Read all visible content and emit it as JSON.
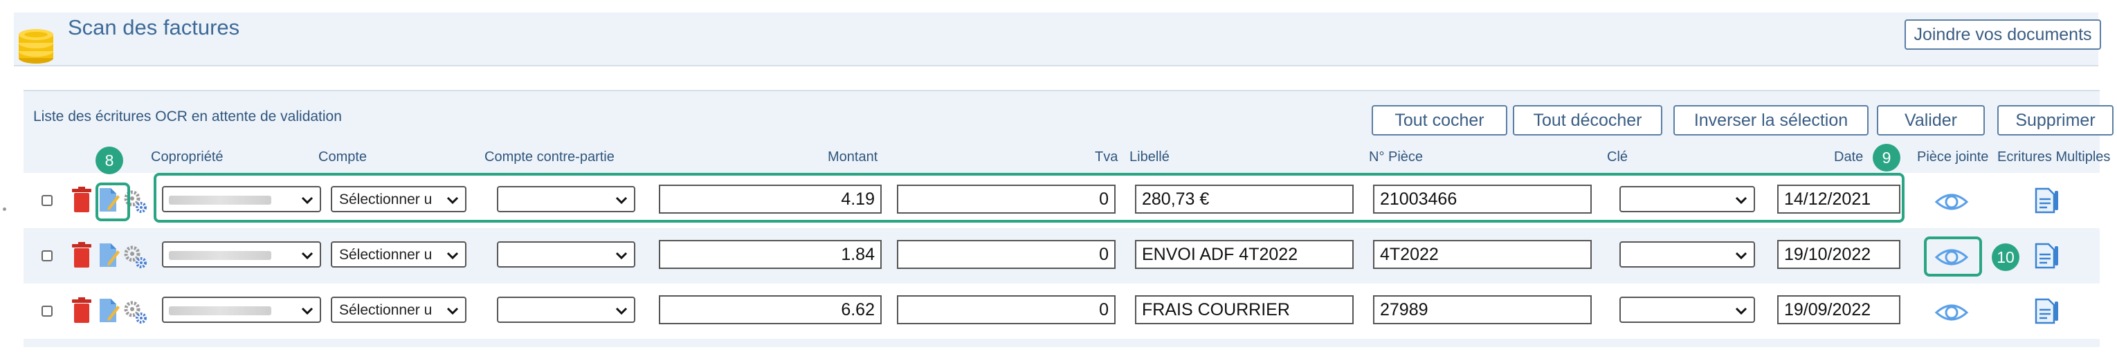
{
  "header": {
    "title": "Scan des factures",
    "join_button": "Joindre vos documents"
  },
  "list": {
    "title": "Liste des écritures OCR en attente de validation",
    "buttons": {
      "check_all": "Tout cocher",
      "uncheck_all": "Tout décocher",
      "invert": "Inverser la sélection",
      "validate": "Valider",
      "delete": "Supprimer"
    },
    "columns": {
      "copropriete": "Copropriété",
      "compte": "Compte",
      "contre_partie": "Compte contre-partie",
      "montant": "Montant",
      "tva": "Tva",
      "libelle": "Libellé",
      "piece": "N° Pièce",
      "cle": "Clé",
      "date": "Date",
      "piece_jointe": "Pièce jointe",
      "ecritures_multiples": "Ecritures Multiples"
    },
    "rows": [
      {
        "compte": "Sélectionner u",
        "montant": "4.19",
        "tva": "0",
        "libelle": "280,73 €",
        "piece": "21003466",
        "date": "14/12/2021"
      },
      {
        "compte": "Sélectionner u",
        "montant": "1.84",
        "tva": "0",
        "libelle": "ENVOI ADF 4T2022",
        "piece": "4T2022",
        "date": "19/10/2022"
      },
      {
        "compte": "Sélectionner u",
        "montant": "6.62",
        "tva": "0",
        "libelle": "FRAIS COURRIER",
        "piece": "27989",
        "date": "19/09/2022"
      }
    ]
  },
  "annotations": {
    "badge_8": "8",
    "badge_9": "9",
    "badge_10": "10"
  },
  "colors": {
    "accent": "#2aa584",
    "title_blue": "#3d6a99",
    "panel_bg": "#eef3f9",
    "trash_red": "#d9342b",
    "edit_blue": "#4a8fd8"
  },
  "icons": [
    "coins-icon",
    "trash-icon",
    "edit-icon",
    "gears-icon",
    "chevron-down-icon",
    "eye-icon",
    "document-icon"
  ]
}
